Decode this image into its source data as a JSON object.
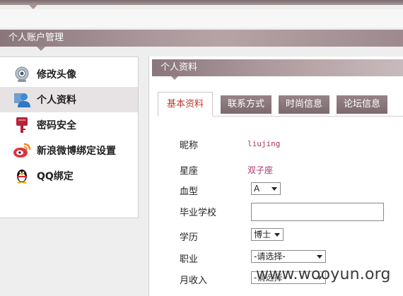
{
  "header": {
    "title": "个人账户管理"
  },
  "sidebar": {
    "items": [
      {
        "label": "修改头像",
        "icon": "webcam-icon"
      },
      {
        "label": "个人资料",
        "icon": "user-icon"
      },
      {
        "label": "密码安全",
        "icon": "key-icon"
      },
      {
        "label": "新浪微博绑定设置",
        "icon": "weibo-icon"
      },
      {
        "label": "QQ绑定",
        "icon": "qq-penguin-icon"
      }
    ],
    "active_index": 1
  },
  "main": {
    "title": "个人资料",
    "tabs": [
      {
        "label": "基本资料"
      },
      {
        "label": "联系方式"
      },
      {
        "label": "时尚信息"
      },
      {
        "label": "论坛信息"
      }
    ],
    "active_tab": 0,
    "form": {
      "nickname_label": "昵称",
      "nickname_value": "liujing",
      "zodiac_label": "星座",
      "zodiac_value": "双子座",
      "blood_label": "血型",
      "blood_value": "A",
      "school_label": "毕业学校",
      "school_value": "",
      "education_label": "学历",
      "education_value": "博士",
      "job_label": "职业",
      "job_value": "-请选择-",
      "income_label": "月收入",
      "income_value": "-请选择-"
    }
  },
  "watermark": "www.wooyun.org",
  "colors": {
    "accent": "#8a767b",
    "highlight": "#b0306a",
    "active_tab_text": "#c0392b"
  }
}
